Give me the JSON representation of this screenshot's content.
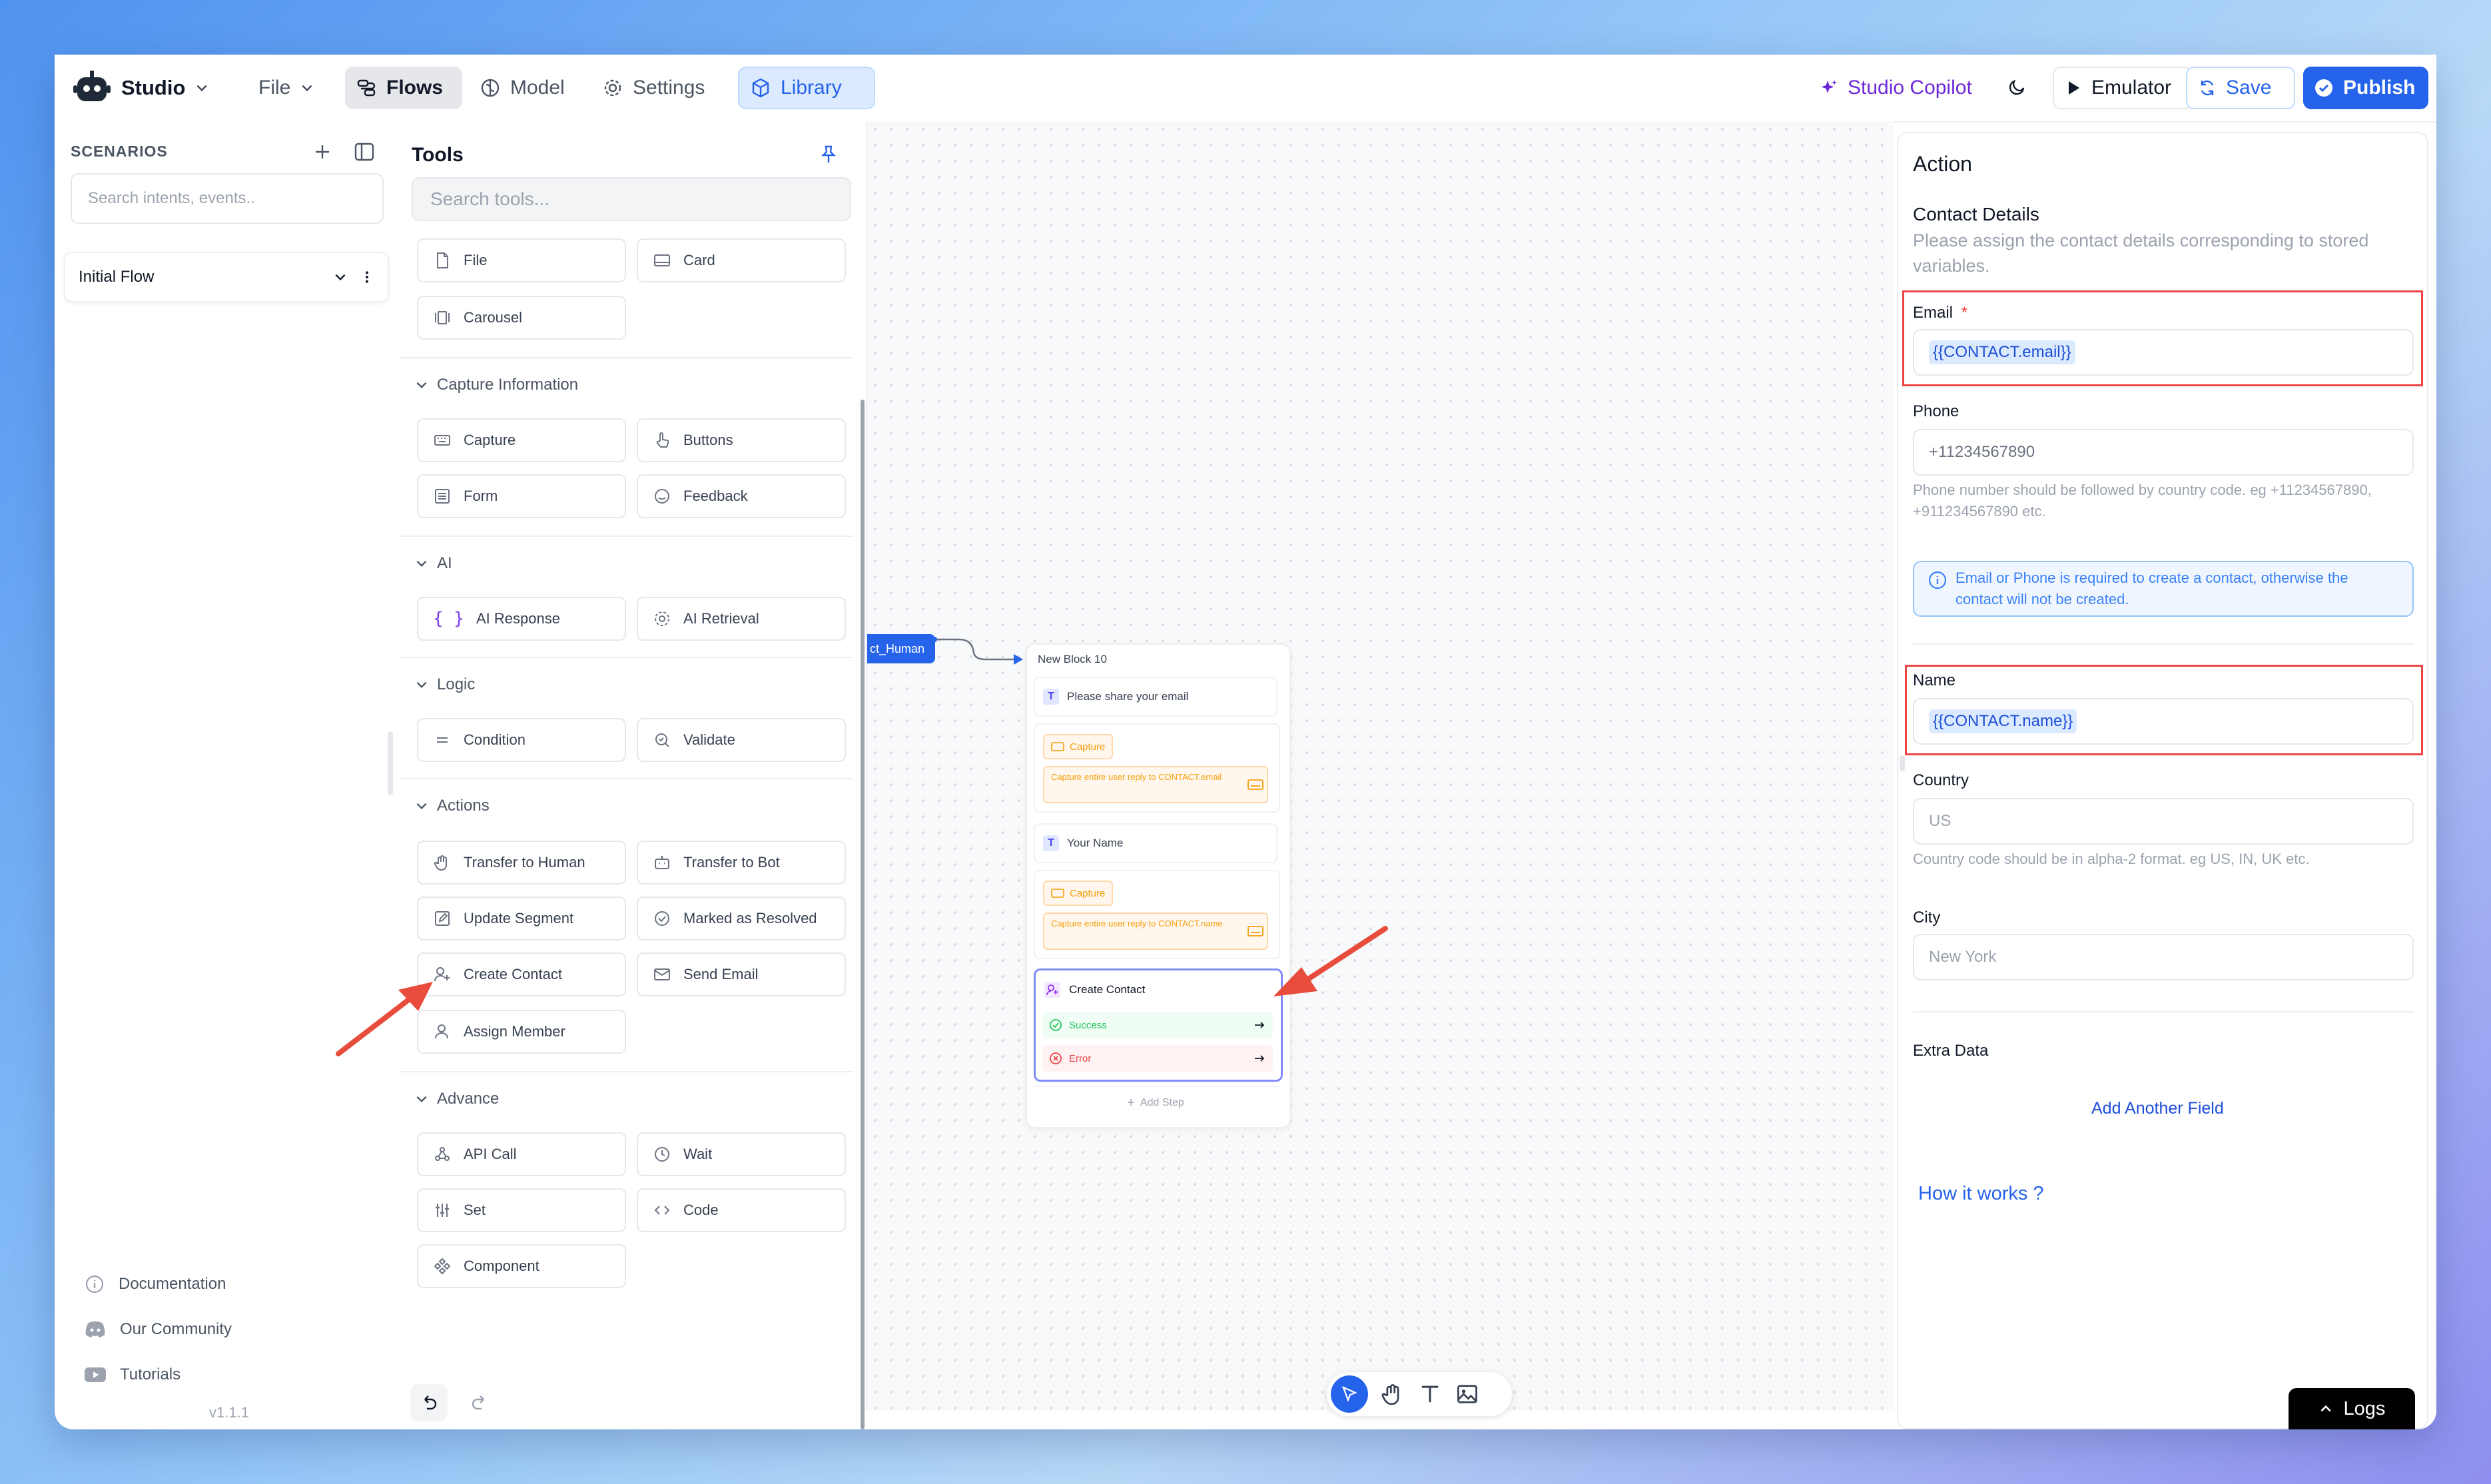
{
  "topbar": {
    "app_name": "Studio",
    "file_label": "File",
    "tabs": [
      {
        "label": "Flows"
      },
      {
        "label": "Model"
      },
      {
        "label": "Settings"
      },
      {
        "label": "Library"
      }
    ],
    "copilot_label": "Studio Copilot",
    "emulator_label": "Emulator",
    "save_label": "Save",
    "publish_label": "Publish"
  },
  "scenarios": {
    "title": "SCENARIOS",
    "search_placeholder": "Search intents, events..",
    "flows": [
      {
        "label": "Initial Flow"
      }
    ],
    "links": [
      {
        "label": "Documentation",
        "icon": "info-circle-icon"
      },
      {
        "label": "Our Community",
        "icon": "discord-icon"
      },
      {
        "label": "Tutorials",
        "icon": "youtube-icon"
      }
    ],
    "version": "v1.1.1"
  },
  "tools": {
    "title": "Tools",
    "search_placeholder": "Search tools...",
    "top_items": [
      "File",
      "Card",
      "Carousel"
    ],
    "sections": [
      {
        "label": "Capture Information",
        "items": [
          "Capture",
          "Buttons",
          "Form",
          "Feedback"
        ]
      },
      {
        "label": "AI",
        "items": [
          "AI Response",
          "AI Retrieval"
        ]
      },
      {
        "label": "Logic",
        "items": [
          "Condition",
          "Validate"
        ]
      },
      {
        "label": "Actions",
        "items": [
          "Transfer to Human",
          "Transfer to Bot",
          "Update Segment",
          "Marked as Resolved",
          "Create Contact",
          "Send Email",
          "Assign Member"
        ]
      },
      {
        "label": "Advance",
        "items": [
          "API Call",
          "Wait",
          "Set",
          "Code",
          "Component"
        ]
      }
    ]
  },
  "canvas": {
    "incoming_node": "ct_Human",
    "block": {
      "title": "New Block 10",
      "step1_text": "Please share your email",
      "capture_label": "Capture",
      "capture1_text": "Capture entire user reply to CONTACT.email",
      "step2_text": "Your Name",
      "capture2_text": "Capture entire user reply to CONTACT.name",
      "action_title": "Create Contact",
      "success_label": "Success",
      "error_label": "Error",
      "add_step_label": "Add Step"
    }
  },
  "action_panel": {
    "title": "Action",
    "section_title": "Contact Details",
    "section_desc": "Please assign the contact details corresponding to stored variables.",
    "email_label": "Email",
    "email_required": "*",
    "email_value": "{{CONTACT.email}}",
    "phone_label": "Phone",
    "phone_value": "+11234567890",
    "phone_help": "Phone number should be followed by country code. eg +11234567890, +911234567890 etc.",
    "info_text": "Email or Phone is required to create a contact, otherwise the contact will not be created.",
    "name_label": "Name",
    "name_value": "{{CONTACT.name}}",
    "country_label": "Country",
    "country_placeholder": "US",
    "country_help": "Country code should be in alpha-2 format. eg US, IN, UK etc.",
    "city_label": "City",
    "city_placeholder": "New York",
    "extra_label": "Extra Data",
    "add_field_label": "Add Another Field",
    "how_it_works": "How it works ?",
    "logs_label": "Logs"
  },
  "colors": {
    "accent": "#2563eb",
    "highlight": "#ef4444",
    "capture_bg": "#fff7ed",
    "capture_text": "#f59e0b"
  }
}
